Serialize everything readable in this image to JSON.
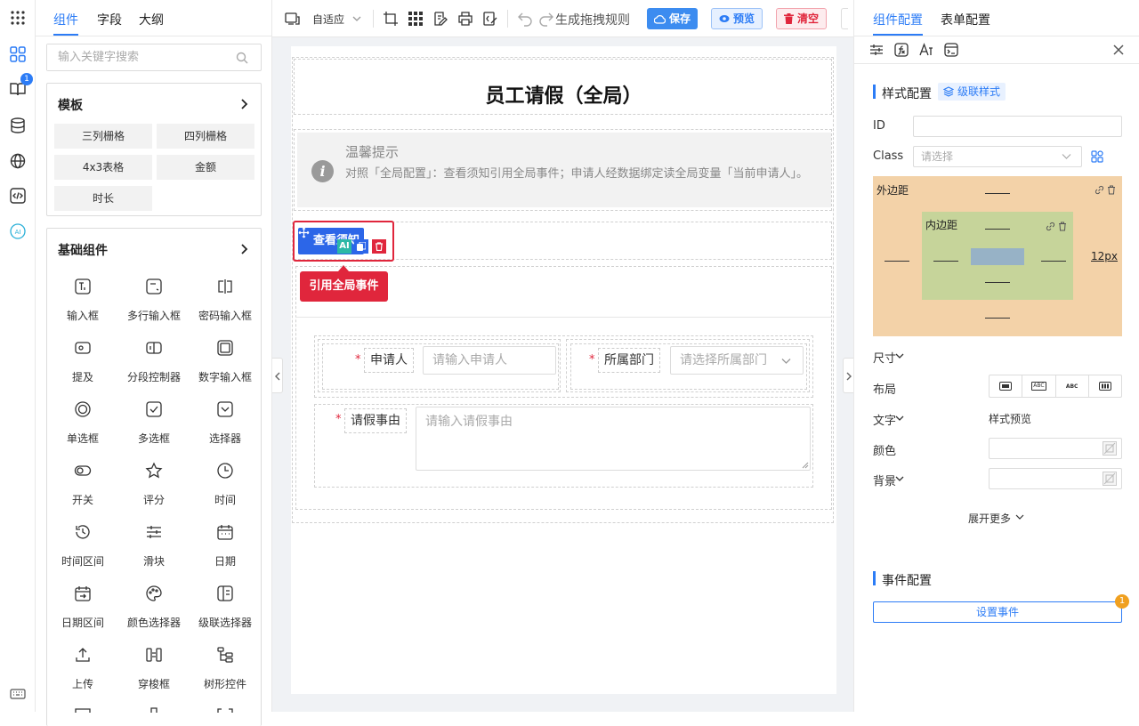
{
  "left_tabs": [
    "组件",
    "字段",
    "大纲"
  ],
  "search": {
    "placeholder": "输入关键字搜索"
  },
  "rail": {
    "badge": "1",
    "ai_label": "AI"
  },
  "templates": {
    "title": "模板",
    "items": [
      "三列栅格",
      "四列栅格",
      "4x3表格",
      "金额",
      "时长"
    ]
  },
  "basic": {
    "title": "基础组件",
    "items": [
      "输入框",
      "多行输入框",
      "密码输入框",
      "提及",
      "分段控制器",
      "数字输入框",
      "单选框",
      "多选框",
      "选择器",
      "开关",
      "评分",
      "时间",
      "时间区间",
      "滑块",
      "日期",
      "日期区间",
      "颜色选择器",
      "级联选择器",
      "上传",
      "穿梭框",
      "树形控件"
    ]
  },
  "toolbar": {
    "adapt_label": "自适应",
    "generate_label": "生成拖拽规则",
    "save_label": "保存",
    "preview_label": "预览",
    "clear_label": "清空"
  },
  "form": {
    "title": "员工请假（全局）",
    "alert_title": "温馨提示",
    "alert_body": "对照「全局配置」：查看须知引用全局事件；申请人经数据绑定读全局变量「当前申请人」。",
    "notice_button": "查看须知",
    "ai_badge": "AI",
    "tooltip": "引用全局事件",
    "fields": {
      "applicant_label": "申请人",
      "applicant_placeholder": "请输入申请人",
      "dept_label": "所属部门",
      "dept_placeholder": "请选择所属部门",
      "reason_label": "请假事由",
      "reason_placeholder": "请输入请假事由",
      "required_mark": "*"
    }
  },
  "right": {
    "tabs": [
      "组件配置",
      "表单配置"
    ],
    "style_config": "样式配置",
    "cascade_style": "级联样式",
    "id_label": "ID",
    "id_value": "",
    "class_label": "Class",
    "class_placeholder": "请选择",
    "margin_label": "外边距",
    "padding_label": "内边距",
    "box_value_12": "12px",
    "size_label": "尺寸",
    "layout_label": "布局",
    "layout_options": [
      "",
      "ABC",
      "ABC",
      ""
    ],
    "text_label": "文字",
    "style_preview": "样式预览",
    "color_label": "颜色",
    "bg_label": "背景",
    "expand_more": "展开更多",
    "event_config": "事件配置",
    "set_event": "设置事件",
    "event_badge": "1"
  },
  "colors": {
    "primary": "#2c7cf6",
    "danger": "#e0263c",
    "margin_bg": "#f3d2a8",
    "padding_bg": "#c6d49a",
    "content_bg": "#97b2c6",
    "badge_orange": "#f0a020"
  }
}
